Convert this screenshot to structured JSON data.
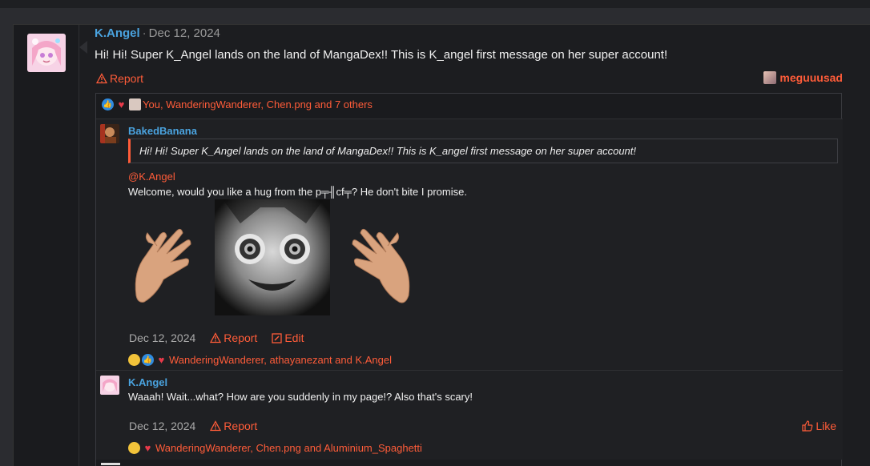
{
  "post": {
    "author": "K.Angel",
    "separator": "·",
    "date": "Dec 12, 2024",
    "message": "Hi! Hi! Super K_Angel lands on the land of MangaDex!! This is K_angel first message on her super account!",
    "report_label": "Report",
    "poster_user": "meguuusad",
    "reactions_text": "You, WanderingWanderer, Chen.png and 7 others"
  },
  "replies": [
    {
      "author": "BakedBanana",
      "quote": "Hi! Hi! Super K_Angel lands on the land of MangaDex!! This is K_angel first message on her super account!",
      "mention": "@K.Angel",
      "text": "Welcome, would you like a hug from the p╤╢cf╤? He don't bite I promise.",
      "date": "Dec 12, 2024",
      "report_label": "Report",
      "edit_label": "Edit",
      "reactions_text": "WanderingWanderer, athayanezant and K.Angel"
    },
    {
      "author": "K.Angel",
      "text": "Waaah! Wait...what? How are you suddenly in my page!? Also that's scary!",
      "date": "Dec 12, 2024",
      "report_label": "Report",
      "like_label": "Like",
      "reactions_text": "WanderingWanderer, Chen.png and Aluminium_Spaghetti"
    }
  ],
  "colors": {
    "accent": "#ff5c39",
    "username": "#4aa3df",
    "background": "#2b2c30"
  }
}
